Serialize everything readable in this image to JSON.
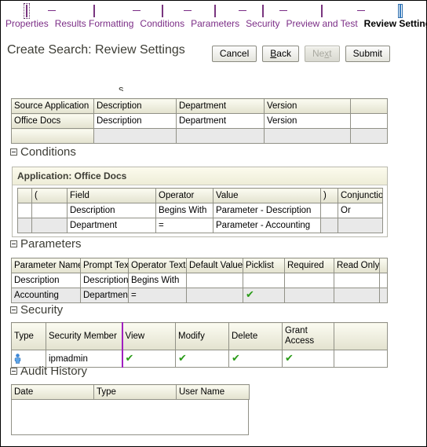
{
  "stepper": {
    "steps": [
      {
        "label": "Properties",
        "state": "done",
        "focused": true
      },
      {
        "label": "Results Formatting",
        "state": "done",
        "focused": false
      },
      {
        "label": "Conditions",
        "state": "done",
        "focused": false
      },
      {
        "label": "Parameters",
        "state": "done",
        "focused": false
      },
      {
        "label": "Security",
        "state": "done",
        "focused": false
      },
      {
        "label": "Preview and Test",
        "state": "done",
        "focused": false
      },
      {
        "label": "Review Settings",
        "state": "current",
        "focused": false
      }
    ],
    "accent_color": "#7b2d86",
    "current_color": "#3a7fc1"
  },
  "header": {
    "title": "Create Search: Review Settings"
  },
  "toolbar": {
    "cancel_label": "Cancel",
    "back_label_prefix": "B",
    "back_label_rest": "ack",
    "next_label_prefix": "Ne",
    "next_label_mnemonic": "x",
    "next_label_rest": "t",
    "submit_label": "Submit",
    "next_disabled": true
  },
  "source_applications": {
    "headers": [
      "Source Application",
      "Description",
      "Department",
      "Version",
      ""
    ],
    "rows": [
      {
        "cells": [
          "Office Docs",
          "Description",
          "Department",
          "Version",
          ""
        ],
        "style": "normal"
      },
      {
        "cells": [
          "",
          "",
          "",
          "",
          ""
        ],
        "style": "alt"
      }
    ]
  },
  "conditions": {
    "section_title": "Conditions",
    "application_label": "Application: Office Docs",
    "headers": [
      "",
      "(",
      "Field",
      "Operator",
      "Value",
      ")",
      "Conjunction"
    ],
    "rows": [
      {
        "cells": [
          "",
          "",
          "Description",
          "Begins With",
          "Parameter - Description",
          "",
          "Or"
        ],
        "style": "normal"
      },
      {
        "cells": [
          "",
          "",
          "Department",
          "=",
          "Parameter - Accounting",
          "",
          ""
        ],
        "style": "alt"
      }
    ]
  },
  "parameters": {
    "section_title": "Parameters",
    "headers": [
      "Parameter Name",
      "Prompt Text",
      "Operator Text",
      "Default Value",
      "Picklist",
      "Required",
      "Read Only",
      ""
    ],
    "rows": [
      {
        "cells": [
          "Description",
          "Description",
          "Begins With",
          "",
          "",
          "",
          "",
          ""
        ],
        "checks": [
          false,
          false,
          false,
          false,
          false,
          false,
          false,
          false
        ],
        "style": "normal"
      },
      {
        "cells": [
          "Accounting",
          "Department",
          "=",
          "",
          "",
          "",
          "",
          ""
        ],
        "checks": [
          false,
          false,
          false,
          false,
          true,
          false,
          false,
          false
        ],
        "style": "alt"
      }
    ]
  },
  "security": {
    "section_title": "Security",
    "headers": [
      "Type",
      "Security Member",
      "View",
      "Modify",
      "Delete",
      "Grant Access",
      ""
    ],
    "rows": [
      {
        "type_icon": "user-icon",
        "member": "ipmadmin",
        "view": true,
        "modify": true,
        "delete": true,
        "grant_access": true
      }
    ]
  },
  "audit_history": {
    "section_title": "Audit History",
    "headers": [
      "Date",
      "Type",
      "User Name"
    ],
    "rows": []
  },
  "check_mark": "✔",
  "colors": {
    "accent_purple": "#7b2d86",
    "check_green": "#2a9b18",
    "header_beige": "#eeedd8",
    "divider_purple": "#a020c0"
  }
}
